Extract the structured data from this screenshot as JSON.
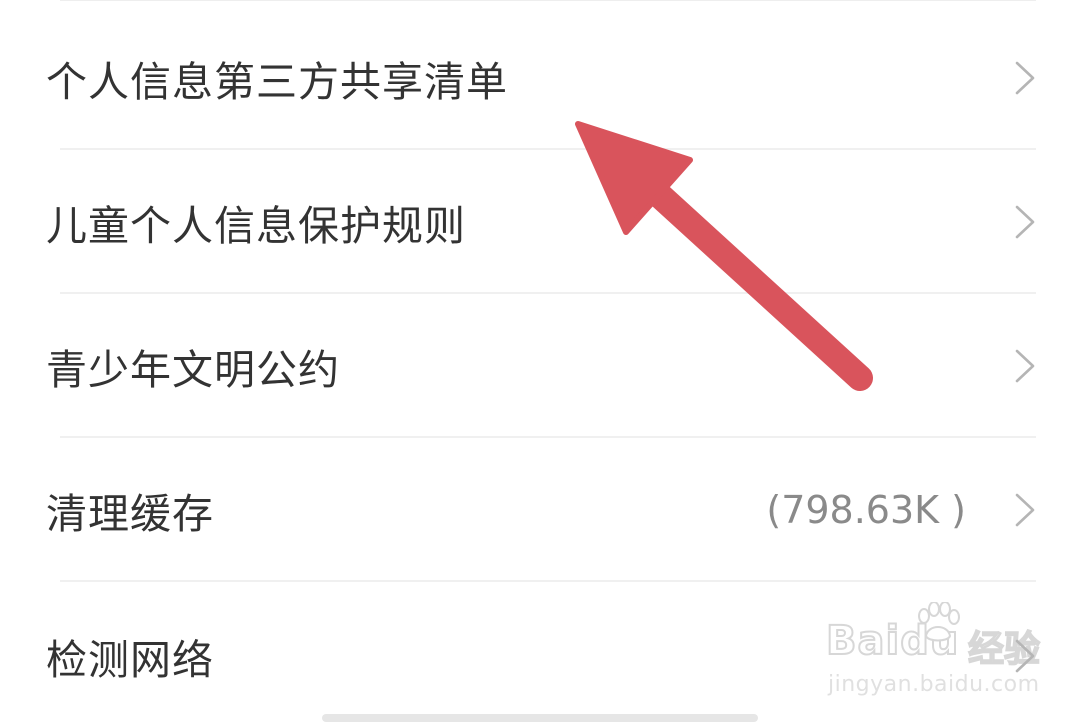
{
  "settings": {
    "items": [
      {
        "label": "个人信息第三方共享清单",
        "value": ""
      },
      {
        "label": "儿童个人信息保护规则",
        "value": ""
      },
      {
        "label": "青少年文明公约",
        "value": ""
      },
      {
        "label": "清理缓存",
        "value": "(798.63K )"
      },
      {
        "label": "检测网络",
        "value": ""
      }
    ]
  },
  "annotation": {
    "arrow_color": "#d9545c"
  },
  "watermark": {
    "brand": "Bai",
    "brand_suffix": "du",
    "brand_cn": "经验",
    "url": "jingyan.baidu.com"
  },
  "colors": {
    "label_text": "#333333",
    "value_text": "#8a8a8a",
    "chevron": "#b5b5b5",
    "divider": "#f0f0f0",
    "background": "#ffffff"
  },
  "icons": {
    "chevron": "chevron-right-icon",
    "arrow": "annotation-arrow-icon",
    "paw": "baidu-paw-icon"
  }
}
